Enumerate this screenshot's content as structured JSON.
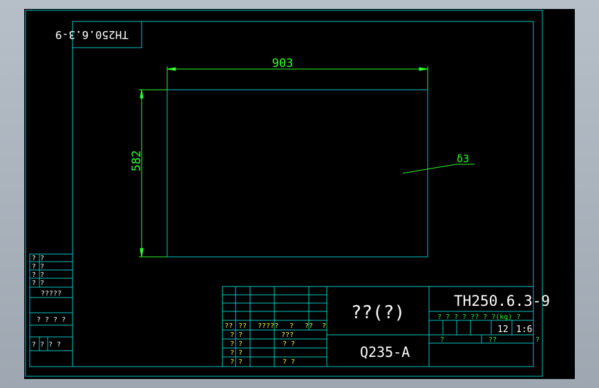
{
  "colors": {
    "viewport_bg": "#000000",
    "frame_line": "#00c8c8",
    "dim_line": "#2dff2d",
    "text_white": "#ffffff",
    "text_green": "#2dff2d",
    "text_yellow": "#ffff40"
  },
  "drawing": {
    "mirrored_code": "TH250.6.3-9",
    "dim_width": "903",
    "dim_height": "582",
    "thickness": "δ3"
  },
  "side_table": {
    "row1": "? ?",
    "row2": "? ?",
    "row3": "? ?",
    "row4": "? ?",
    "row5": "?????",
    "row6": "? ? ? ?",
    "row7": "? ? ? ?"
  },
  "title_block": {
    "name": "??(?)",
    "material": "Q235-A",
    "code": "TH250.6.3-9",
    "header_row": "? ? ? ? ?? ? ?(kg) ?",
    "quantity": "12",
    "scale": "1:6",
    "sheet_label": "?",
    "sheet_label2": "??",
    "sheet_label3": "?",
    "sig_row": {
      "c1": "??",
      "c2": "??",
      "c3": "?????",
      "c4": "?",
      "c5": "??",
      "c6": "?"
    },
    "sig_rows": [
      {
        "c1": "? ?",
        "c2": "???"
      },
      {
        "c1": "? ?",
        "c2": "? ?"
      },
      {
        "c1": "? ?",
        "c2": ""
      },
      {
        "c1": "? ?",
        "c2": "? ?"
      }
    ]
  }
}
